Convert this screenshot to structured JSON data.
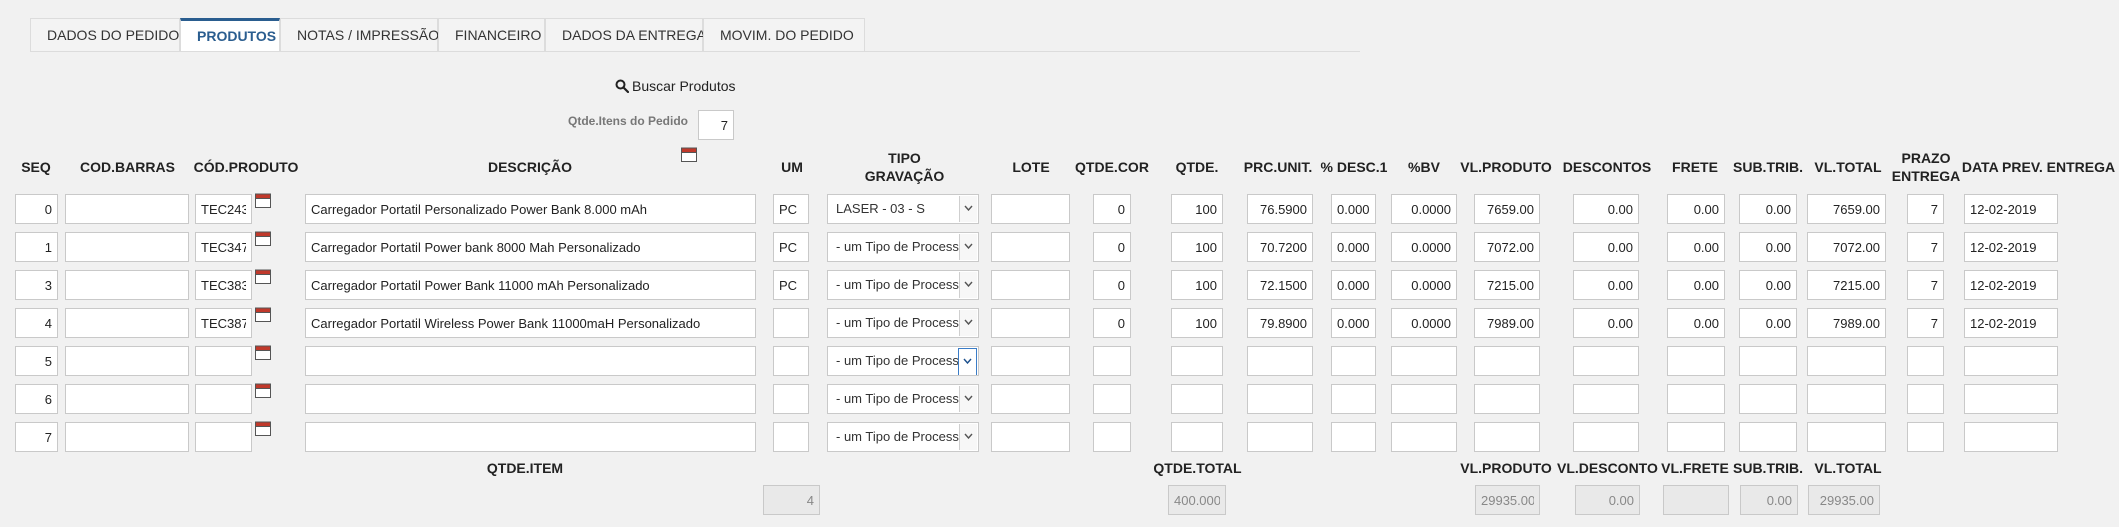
{
  "tabs": [
    {
      "label": "DADOS DO PEDIDO"
    },
    {
      "label": "PRODUTOS"
    },
    {
      "label": "NOTAS / IMPRESSÃO"
    },
    {
      "label": "FINANCEIRO"
    },
    {
      "label": "DADOS DA ENTREGA"
    },
    {
      "label": "MOVIM. DO PEDIDO"
    }
  ],
  "active_tab": "PRODUTOS",
  "search": {
    "label": "Buscar Produtos"
  },
  "qtde_itens": {
    "label": "Qtde.Itens do Pedido",
    "value": "7"
  },
  "headers": {
    "seq": "SEQ",
    "cod_barras": "COD.BARRAS",
    "cod_produto": "CÓD.PRODUTO",
    "descricao": "DESCRIÇÃO",
    "um": "UM",
    "tipo_gravacao_1": "TIPO",
    "tipo_gravacao_2": "GRAVAÇÃO",
    "lote": "LOTE",
    "qtde_cor": "QTDE.COR",
    "qtde": "QTDE.",
    "prc_unit": "PRC.UNIT.",
    "desc1": "% DESC.1",
    "bv": "%BV",
    "vl_produto": "VL.PRODUTO",
    "descontos": "DESCONTOS",
    "frete": "FRETE",
    "sub_trib": "SUB.TRIB.",
    "vl_total": "VL.TOTAL",
    "prazo_1": "PRAZO",
    "prazo_2": "ENTREGA",
    "data_prev": "DATA PREV. ENTREGA"
  },
  "rows": [
    {
      "seq": "0",
      "cod_barras": "",
      "cod_produto": "TEC243",
      "descricao": "Carregador Portatil Personalizado Power Bank 8.000 mAh",
      "um": "PC",
      "tipo": "LASER - 03 - S",
      "lote": "",
      "qtde_cor": "0",
      "qtde": "100",
      "prc_unit": "76.5900",
      "desc1": "0.0000",
      "bv": "0.0000",
      "vl_produto": "7659.00",
      "descontos": "0.00",
      "frete": "0.00",
      "sub_trib": "0.00",
      "vl_total": "7659.00",
      "prazo": "7",
      "data_prev": "12-02-2019"
    },
    {
      "seq": "1",
      "cod_barras": "",
      "cod_produto": "TEC347",
      "descricao": "Carregador Portatil Power bank 8000 Mah Personalizado",
      "um": "PC",
      "tipo": "- um Tipo de Processo -",
      "lote": "",
      "qtde_cor": "0",
      "qtde": "100",
      "prc_unit": "70.7200",
      "desc1": "0.0000",
      "bv": "0.0000",
      "vl_produto": "7072.00",
      "descontos": "0.00",
      "frete": "0.00",
      "sub_trib": "0.00",
      "vl_total": "7072.00",
      "prazo": "7",
      "data_prev": "12-02-2019"
    },
    {
      "seq": "3",
      "cod_barras": "",
      "cod_produto": "TEC383",
      "descricao": "Carregador Portatil Power Bank 11000 mAh Personalizado",
      "um": "PC",
      "tipo": "- um Tipo de Processo -",
      "lote": "",
      "qtde_cor": "0",
      "qtde": "100",
      "prc_unit": "72.1500",
      "desc1": "0.0000",
      "bv": "0.0000",
      "vl_produto": "7215.00",
      "descontos": "0.00",
      "frete": "0.00",
      "sub_trib": "0.00",
      "vl_total": "7215.00",
      "prazo": "7",
      "data_prev": "12-02-2019"
    },
    {
      "seq": "4",
      "cod_barras": "",
      "cod_produto": "TEC387",
      "descricao": "Carregador Portatil Wireless Power Bank 11000maH Personalizado",
      "um": "",
      "tipo": "- um Tipo de Processo -",
      "lote": "",
      "qtde_cor": "0",
      "qtde": "100",
      "prc_unit": "79.8900",
      "desc1": "0.0000",
      "bv": "0.0000",
      "vl_produto": "7989.00",
      "descontos": "0.00",
      "frete": "0.00",
      "sub_trib": "0.00",
      "vl_total": "7989.00",
      "prazo": "7",
      "data_prev": "12-02-2019"
    },
    {
      "seq": "5",
      "cod_barras": "",
      "cod_produto": "",
      "descricao": "",
      "um": "",
      "tipo": "- um Tipo de Processo -",
      "lote": "",
      "qtde_cor": "",
      "qtde": "",
      "prc_unit": "",
      "desc1": "",
      "bv": "",
      "vl_produto": "",
      "descontos": "",
      "frete": "",
      "sub_trib": "",
      "vl_total": "",
      "prazo": "",
      "data_prev": ""
    },
    {
      "seq": "6",
      "cod_barras": "",
      "cod_produto": "",
      "descricao": "",
      "um": "",
      "tipo": "- um Tipo de Processo -",
      "lote": "",
      "qtde_cor": "",
      "qtde": "",
      "prc_unit": "",
      "desc1": "",
      "bv": "",
      "vl_produto": "",
      "descontos": "",
      "frete": "",
      "sub_trib": "",
      "vl_total": "",
      "prazo": "",
      "data_prev": ""
    },
    {
      "seq": "7",
      "cod_barras": "",
      "cod_produto": "",
      "descricao": "",
      "um": "",
      "tipo": "- um Tipo de Processo -",
      "lote": "",
      "qtde_cor": "",
      "qtde": "",
      "prc_unit": "",
      "desc1": "",
      "bv": "",
      "vl_produto": "",
      "descontos": "",
      "frete": "",
      "sub_trib": "",
      "vl_total": "",
      "prazo": "",
      "data_prev": ""
    }
  ],
  "totals": {
    "qtde_item_label": "QTDE.ITEM",
    "qtde_item": "4",
    "qtde_total_label": "QTDE.TOTAL",
    "qtde_total": "400.0000",
    "vl_produto_label": "VL.PRODUTO",
    "vl_produto": "29935.00",
    "vl_desconto_label": "VL.DESCONTO",
    "vl_desconto": "0.00",
    "vl_frete_label": "VL.FRETE",
    "vl_frete": "",
    "sub_trib_label": "SUB.TRIB.",
    "sub_trib": "0.00",
    "vl_total_label": "VL.TOTAL",
    "vl_total": "29935.00"
  },
  "icons": {
    "search": "search-icon",
    "calendar": "calendar-icon",
    "select_arrow": "chevron-down-icon"
  },
  "colors": {
    "accent": "#2a5d8f",
    "background": "#f1f1f1",
    "calendar": "#c0392b"
  }
}
